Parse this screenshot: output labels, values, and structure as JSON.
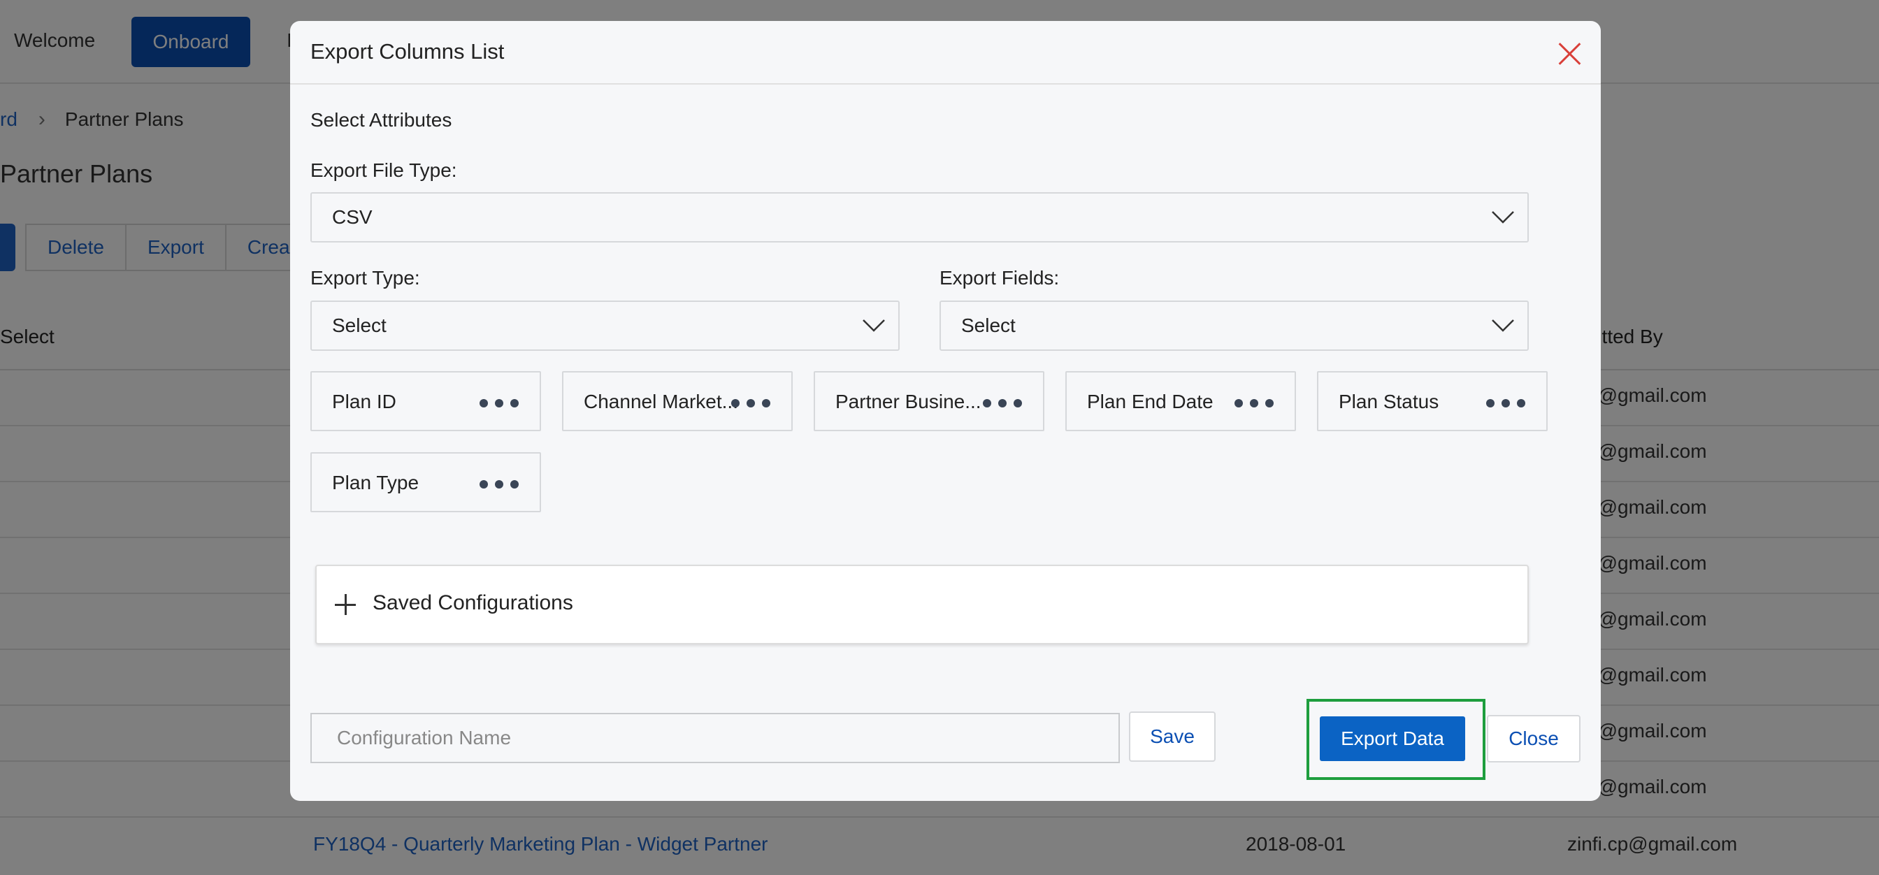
{
  "background": {
    "topbar": {
      "welcome": "Welcome",
      "onboard_label": "Onboard",
      "extra_label": "I"
    },
    "breadcrumb": {
      "link": "rd",
      "current": "Partner Plans"
    },
    "page_title": "Partner Plans",
    "actions": [
      "Delete",
      "Export",
      "Create"
    ],
    "table": {
      "headers": {
        "select": "Select",
        "submitted_by": "mitted By"
      },
      "rows": [
        {
          "email": "i.cp@gmail.com"
        },
        {
          "email": "i.cp@gmail.com"
        },
        {
          "email": "i.cp@gmail.com"
        },
        {
          "email": "i.cp@gmail.com"
        },
        {
          "email": "i.cp@gmail.com"
        },
        {
          "email": "i.cp@gmail.com"
        },
        {
          "email": "i.cp@gmail.com"
        },
        {
          "email": "i.cp@gmail.com"
        }
      ],
      "last_row": {
        "name": "FY18Q4 - Quarterly Marketing Plan - Widget Partner",
        "date": "2018-08-01",
        "email": "zinfi.cp@gmail.com"
      }
    }
  },
  "modal": {
    "title": "Export Columns List",
    "section_label": "Select Attributes",
    "file_type": {
      "label": "Export File Type:",
      "value": "CSV"
    },
    "export_type": {
      "label": "Export Type:",
      "value": "Select"
    },
    "export_fields": {
      "label": "Export Fields:",
      "value": "Select"
    },
    "columns": [
      {
        "label": "Plan ID"
      },
      {
        "label": "Channel Market..."
      },
      {
        "label": "Partner Busine..."
      },
      {
        "label": "Plan End Date"
      },
      {
        "label": "Plan Status"
      },
      {
        "label": "Plan Type"
      }
    ],
    "saved_configurations_label": "Saved Configurations",
    "config_name_placeholder": "Configuration Name",
    "save_label": "Save",
    "export_label": "Export Data",
    "close_label": "Close",
    "colors": {
      "primary": "#0b63c4",
      "highlight": "#1e9e3e",
      "close_icon": "#d9403a"
    }
  }
}
